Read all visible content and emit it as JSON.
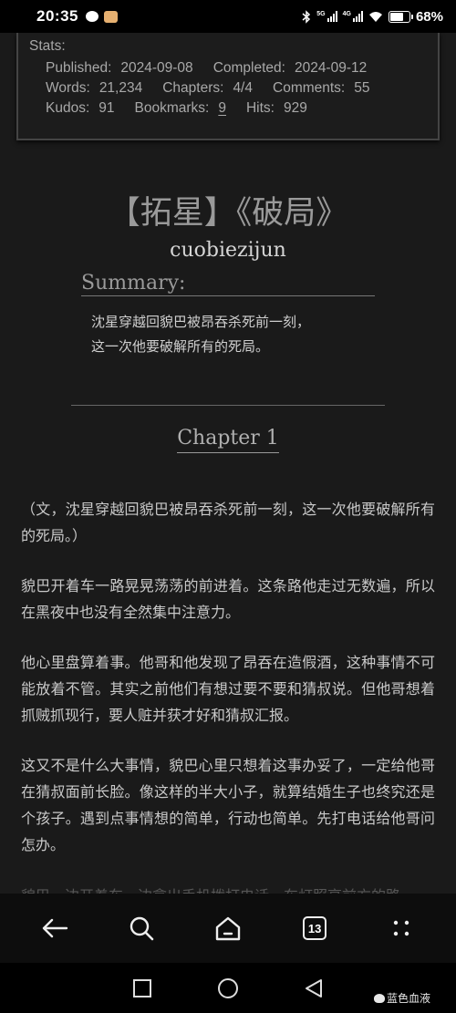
{
  "status_bar": {
    "time": "20:35",
    "network_1": "5G",
    "network_2": "4G",
    "battery": "68%",
    "battery_level": 0.68
  },
  "stats": {
    "title": "Stats:",
    "published_label": "Published:",
    "published": "2024-09-08",
    "completed_label": "Completed:",
    "completed": "2024-09-12",
    "words_label": "Words:",
    "words": "21,234",
    "chapters_label": "Chapters:",
    "chapters": "4/4",
    "comments_label": "Comments:",
    "comments": "55",
    "kudos_label": "Kudos:",
    "kudos": "91",
    "bookmarks_label": "Bookmarks:",
    "bookmarks": "9",
    "hits_label": "Hits:",
    "hits": "929"
  },
  "work": {
    "title": "【拓星】《破局》",
    "author": "cuobiezijun",
    "summary_heading": "Summary:",
    "summary_lines": [
      "沈星穿越回貌巴被昂吞杀死前一刻，",
      "这一次他要破解所有的死局。"
    ]
  },
  "chapter": {
    "heading": "Chapter 1",
    "paragraphs": [
      "（文，沈星穿越回貌巴被昂吞杀死前一刻，这一次他要破解所有的死局。）",
      "貌巴开着车一路晃晃荡荡的前进着。这条路他走过无数遍，所以在黑夜中也没有全然集中注意力。",
      "他心里盘算着事。他哥和他发现了昂吞在造假酒，这种事情不可能放着不管。其实之前他们有想过要不要和猜叔说。但他哥想着抓贼抓现行，要人赃并获才好和猜叔汇报。",
      "这又不是什么大事情，貌巴心里只想着这事办妥了，一定给他哥在猜叔面前长脸。像这样的半大小子，就算结婚生子也终究还是个孩子。遇到点事情想的简单，行动也简单。先打电话给他哥问怎办。"
    ],
    "cut_line": "貌巴一边开着车一边拿出手机拨打电话，车灯照亮前方的路。"
  },
  "navbar": {
    "tab_count": "13",
    "icons": [
      "back-arrow-icon",
      "search-icon",
      "home-icon",
      "tabs-icon",
      "more-dots-icon"
    ]
  },
  "system_nav": {
    "icons": [
      "recents-square-icon",
      "home-circle-icon",
      "back-triangle-icon"
    ],
    "watermark": "蓝色血液"
  }
}
